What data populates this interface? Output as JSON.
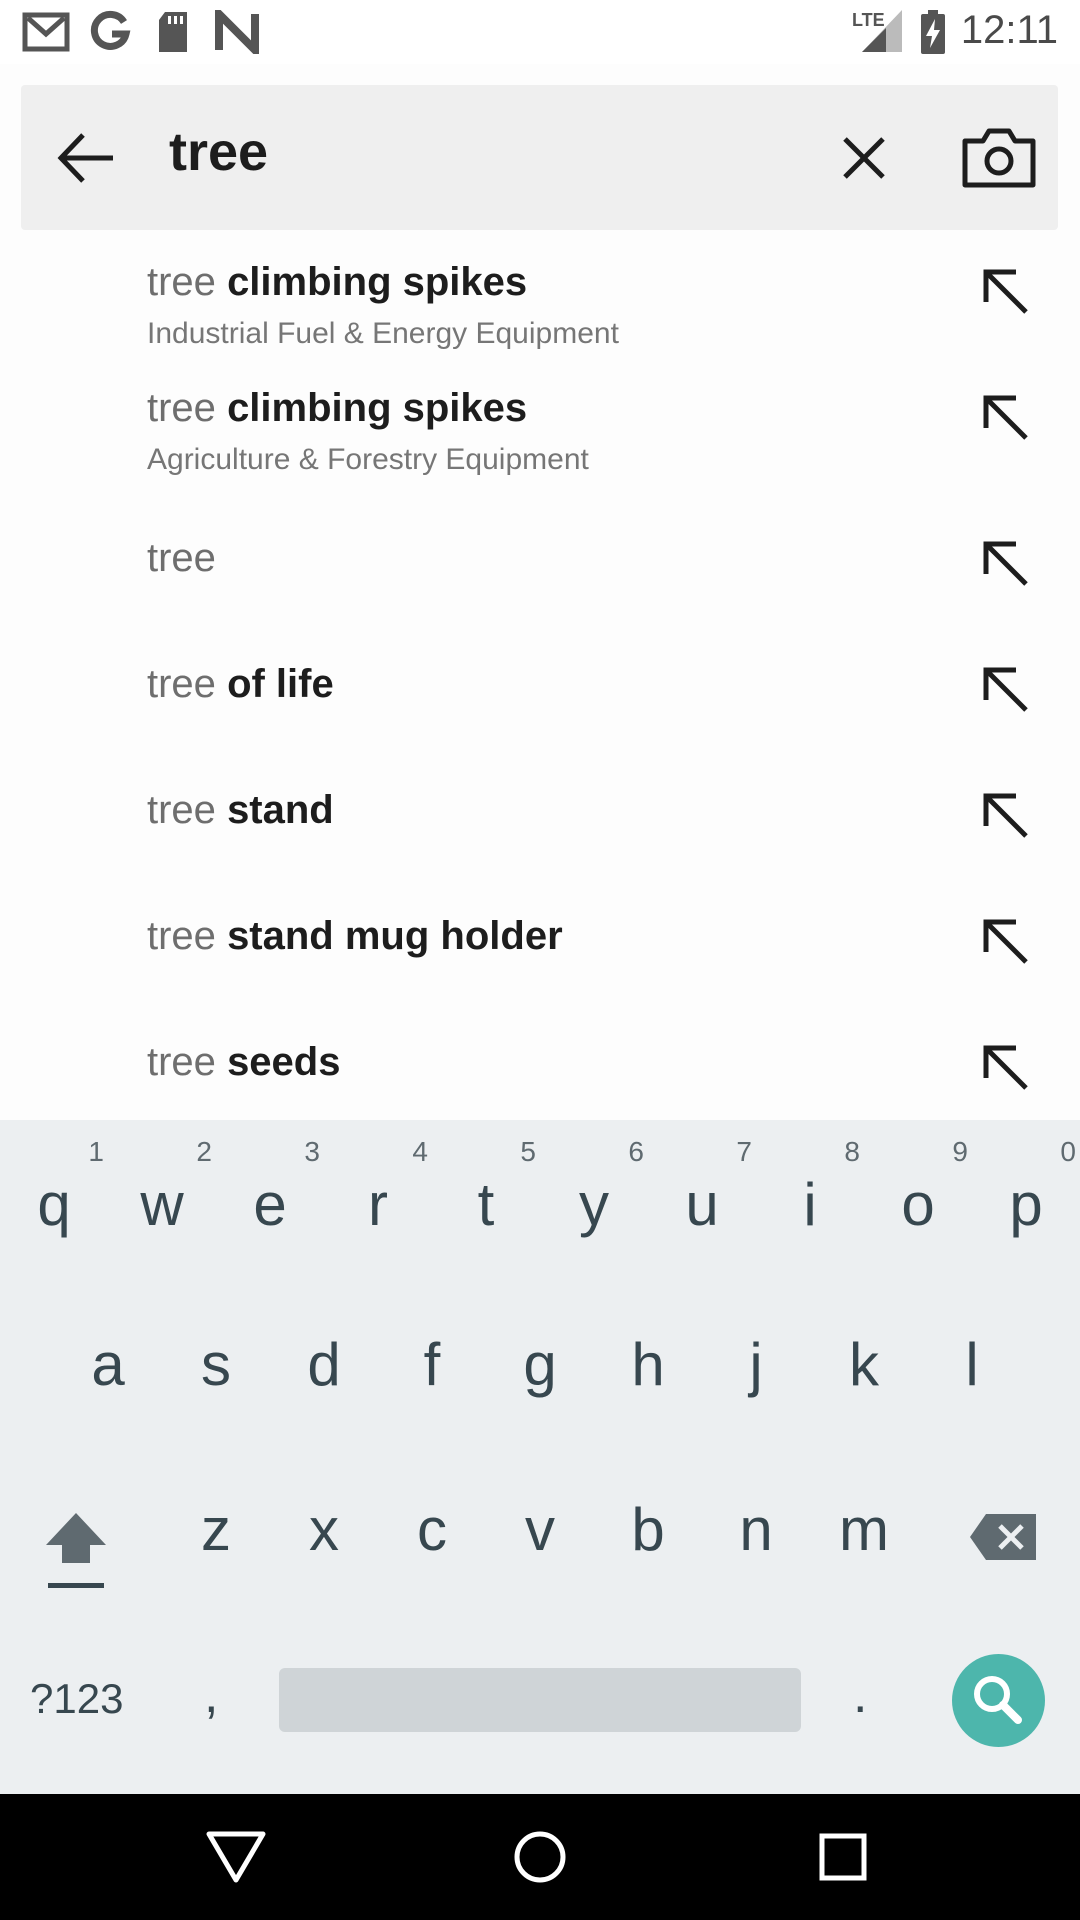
{
  "status_bar": {
    "time": "12:11",
    "network": "LTE",
    "icons": [
      "gmail-icon",
      "google-icon",
      "sd-card-icon",
      "n-icon",
      "signal-icon",
      "battery-charging-icon"
    ]
  },
  "search": {
    "query": "tree",
    "icons": {
      "back": "arrow-left-icon",
      "clear": "close-icon",
      "camera": "camera-icon"
    }
  },
  "suggestions": [
    {
      "prefix": "tree",
      "bold": "climbing spikes",
      "category": "Industrial Fuel & Energy Equipment"
    },
    {
      "prefix": "tree",
      "bold": "climbing spikes",
      "category": "Agriculture & Forestry Equipment"
    },
    {
      "prefix": "tree",
      "bold": "",
      "category": ""
    },
    {
      "prefix": "tree",
      "bold": "of life",
      "category": ""
    },
    {
      "prefix": "tree",
      "bold": "stand",
      "category": ""
    },
    {
      "prefix": "tree",
      "bold": "stand mug holder",
      "category": ""
    },
    {
      "prefix": "tree",
      "bold": "seeds",
      "category": ""
    }
  ],
  "keyboard": {
    "row1": [
      {
        "ch": "q",
        "hint": "1"
      },
      {
        "ch": "w",
        "hint": "2"
      },
      {
        "ch": "e",
        "hint": "3"
      },
      {
        "ch": "r",
        "hint": "4"
      },
      {
        "ch": "t",
        "hint": "5"
      },
      {
        "ch": "y",
        "hint": "6"
      },
      {
        "ch": "u",
        "hint": "7"
      },
      {
        "ch": "i",
        "hint": "8"
      },
      {
        "ch": "o",
        "hint": "9"
      },
      {
        "ch": "p",
        "hint": "0"
      }
    ],
    "row2": [
      "a",
      "s",
      "d",
      "f",
      "g",
      "h",
      "j",
      "k",
      "l"
    ],
    "row3": [
      "z",
      "x",
      "c",
      "v",
      "b",
      "n",
      "m"
    ],
    "symbols_label": "?123",
    "comma": ",",
    "period": ".",
    "accent_color": "#4db6ac"
  },
  "nav_bar": {
    "icons": [
      "back-triangle-icon",
      "home-circle-icon",
      "recents-square-icon"
    ]
  }
}
